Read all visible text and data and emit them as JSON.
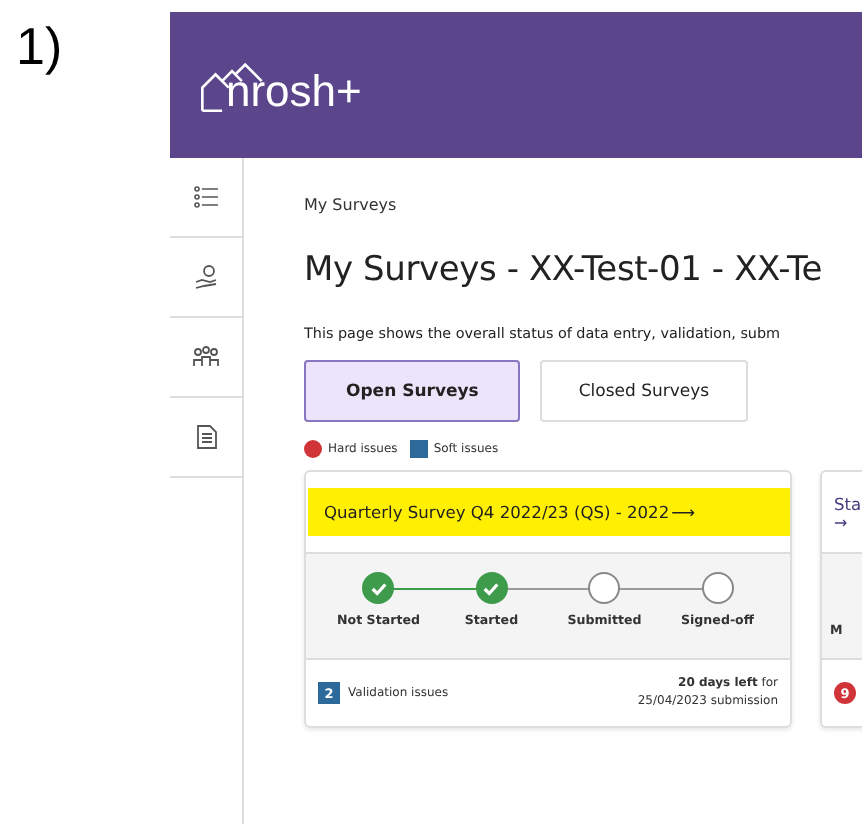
{
  "figure_label": "1)",
  "header": {
    "logo_text": "nrosh+"
  },
  "sidebar": {
    "items": [
      {
        "kind": "list"
      },
      {
        "kind": "hand"
      },
      {
        "kind": "people"
      },
      {
        "kind": "document"
      }
    ]
  },
  "breadcrumb": "My Surveys",
  "title": "My Surveys - XX-Test-01 - XX-Te",
  "description": "This page shows the overall status of data entry, validation, subm",
  "tabs": [
    {
      "label": "Open Surveys",
      "selected": true
    },
    {
      "label": "Closed Surveys",
      "selected": false
    }
  ],
  "legend": [
    {
      "kind": "circle",
      "label": "Hard issues",
      "color": "#d13438"
    },
    {
      "kind": "square",
      "label": "Soft issues",
      "color": "#2b6a9b"
    }
  ],
  "cards": [
    {
      "title": "Quarterly Survey Q4 2022/23 (QS) - 2022",
      "arrow": "⟶",
      "highlighted": true,
      "steps": [
        {
          "label": "Not Started",
          "done": true
        },
        {
          "label": "Started",
          "done": true
        },
        {
          "label": "Submitted",
          "done": false
        },
        {
          "label": "Signed-off",
          "done": false
        }
      ],
      "issues": {
        "kind": "soft",
        "count": "2",
        "label": "Validation issues"
      },
      "deadline": {
        "days": "20 days left",
        "rest": "for",
        "date": "25/04/2023 submission"
      }
    }
  ],
  "partial_card": {
    "title": "Sta",
    "arrow": "→",
    "step": "M",
    "issues": {
      "kind": "hard",
      "count": "9"
    }
  }
}
